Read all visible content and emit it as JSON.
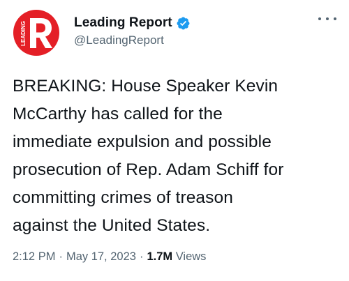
{
  "account": {
    "display_name": "Leading Report",
    "handle": "@LeadingReport",
    "avatar_logo_letter": "R",
    "avatar_logo_text": "LEADING",
    "verified": true
  },
  "menu": {
    "icon": "more-horizontal-icon"
  },
  "tweet": {
    "lines": [
      "BREAKING: House Speaker Kevin",
      "McCarthy has called for the",
      "immediate expulsion and possible",
      "prosecution of Rep. Adam Schiff for",
      "committing crimes of treason",
      "against the United States."
    ]
  },
  "meta": {
    "time": "2:12 PM",
    "separator": "·",
    "date": "May 17, 2023",
    "views_count": "1.7M",
    "views_label": "Views"
  },
  "colors": {
    "brand_red": "#e41f26",
    "verified_blue": "#1d9bf0",
    "text_primary": "#0f1419",
    "text_secondary": "#536471"
  }
}
